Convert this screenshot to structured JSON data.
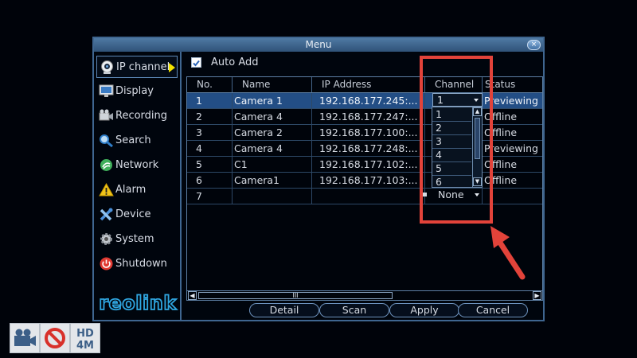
{
  "window": {
    "title": "Menu",
    "close_glyph": "×"
  },
  "sidebar": {
    "items": [
      {
        "label": "IP channel",
        "icon": "webcam-icon",
        "active": true
      },
      {
        "label": "Display",
        "icon": "monitor-icon"
      },
      {
        "label": "Recording",
        "icon": "video-camera-icon"
      },
      {
        "label": "Search",
        "icon": "magnifier-icon"
      },
      {
        "label": "Network",
        "icon": "network-globe-icon"
      },
      {
        "label": "Alarm",
        "icon": "warning-triangle-icon"
      },
      {
        "label": "Device",
        "icon": "tools-icon"
      },
      {
        "label": "System",
        "icon": "gear-icon"
      },
      {
        "label": "Shutdown",
        "icon": "power-icon"
      }
    ],
    "brand": "reolink",
    "accent_color": "#2fa6e0"
  },
  "auto_add": {
    "label": "Auto Add",
    "checked": true
  },
  "table": {
    "columns": [
      "No.",
      "Name",
      "IP Address",
      "Channel",
      "Status"
    ],
    "rows": [
      {
        "no": "1",
        "name": "Camera 1",
        "ip": "192.168.177.245:...",
        "channel": "1",
        "status": "Previewing"
      },
      {
        "no": "2",
        "name": "Camera 4",
        "ip": "192.168.177.247:...",
        "channel": "",
        "status": "Offline"
      },
      {
        "no": "3",
        "name": "Camera 2",
        "ip": "192.168.177.100:...",
        "channel": "",
        "status": "Offline"
      },
      {
        "no": "4",
        "name": "Camera 4",
        "ip": "192.168.177.248:...",
        "channel": "",
        "status": "Previewing"
      },
      {
        "no": "5",
        "name": "C1",
        "ip": "192.168.177.102:...",
        "channel": "",
        "status": "Offline"
      },
      {
        "no": "6",
        "name": "Camera1",
        "ip": "192.168.177.103:...",
        "channel": "",
        "status": "Offline"
      },
      {
        "no": "7",
        "name": "",
        "ip": "",
        "channel": "None",
        "status": ""
      }
    ],
    "selected_row": 0,
    "channel_dropdown": {
      "selected": "1",
      "options": [
        "1",
        "2",
        "3",
        "4",
        "5",
        "6"
      ]
    },
    "hscroll_thumb": "III"
  },
  "buttons": {
    "detail": "Detail",
    "scan": "Scan",
    "apply": "Apply",
    "cancel": "Cancel"
  },
  "annotation": {
    "color": "#e2433a"
  },
  "status_bar": [
    {
      "icon": "video-camera-icon"
    },
    {
      "icon": "no-symbol-icon"
    },
    {
      "icon": "hd-badge-icon",
      "line1": "HD",
      "line2": "4M"
    }
  ]
}
